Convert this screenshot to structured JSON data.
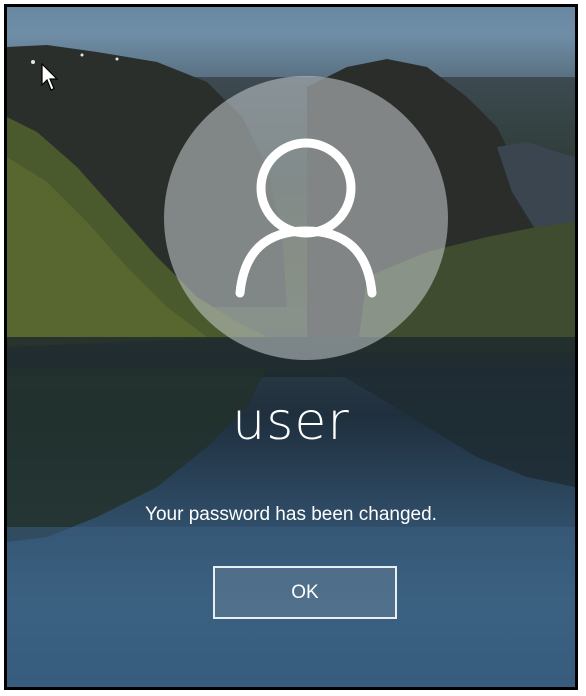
{
  "lockscreen": {
    "username": "user",
    "message": "Your password has been changed.",
    "ok_label": "OK",
    "avatar_icon": "user-silhouette-icon",
    "cursor_icon": "mouse-pointer-icon"
  },
  "colors": {
    "text": "#ffffff",
    "button_border": "#e9eef2",
    "frame_border": "#000000"
  }
}
